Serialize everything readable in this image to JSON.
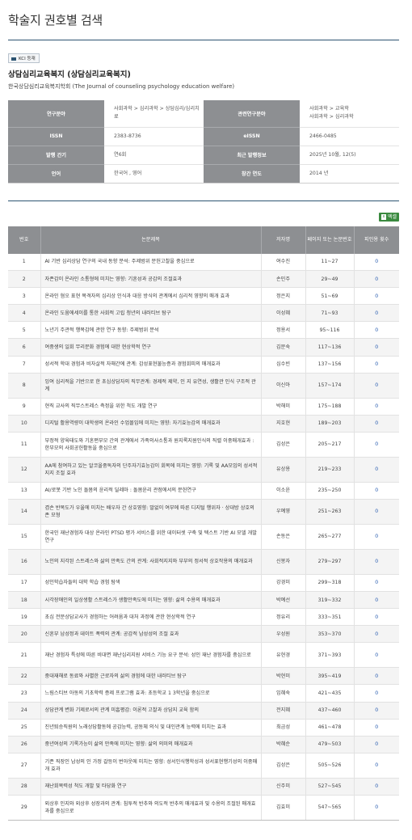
{
  "page": {
    "title": "학술지 권호별 검색"
  },
  "badge": {
    "label": "KCI 등재"
  },
  "journal": {
    "name": "상담심리교육복지 (상담심리교육복지)",
    "publisher": "한국상담심리교육복지학회 (The Journal of counseling psychology education welfare)"
  },
  "info": {
    "research_field_label": "연구분야",
    "research_field_value": "사회과학 > 심리과학 > 상담심리/심리치료",
    "related_field_label": "관련연구분야",
    "related_field_value_1": "사회과학 > 교육학",
    "related_field_value_2": "사회과학 > 심리과학",
    "issn_label": "ISSN",
    "issn_value": "2383-8736",
    "eissn_label": "eISSN",
    "eissn_value": "2466-0485",
    "cycle_label": "발행 간기",
    "cycle_value": "연6회",
    "latest_label": "최근 발행정보",
    "latest_value": "2025년 10월, 12(5)",
    "lang_label": "언어",
    "lang_value": "한국어 , 영어",
    "founded_label": "창간 연도",
    "founded_value": "2014 년"
  },
  "excel": {
    "label": "엑셀"
  },
  "table": {
    "headers": {
      "no": "번호",
      "title": "논문제목",
      "author": "저자명",
      "pages": "페이지 또는 논문번호",
      "cited": "피인용 횟수"
    },
    "rows": [
      {
        "no": "1",
        "title": "AI 기반 심리상담 연구의 국내 동향 분석: 주제범위 문헌고찰을 중심으로",
        "author": "여수진",
        "pages": "11~27",
        "cited": "0"
      },
      {
        "no": "2",
        "title": "자존감이 온라인 소통형에 미치는 영향: 기혼성과 공감의 조절효과",
        "author": "손민주",
        "pages": "29~49",
        "cited": "0"
      },
      {
        "no": "3",
        "title": "온라인 혐오 표현 목격자의 심리상 인식과 대응 방식의 관계에서 심리적 영향의 매개 효과",
        "author": "정은지",
        "pages": "51~69",
        "cited": "0"
      },
      {
        "no": "4",
        "title": "온라인 도움에세이를 통한 사회적 고립 청년의 내러티브 탐구",
        "author": "이성혜",
        "pages": "71~93",
        "cited": "0"
      },
      {
        "no": "5",
        "title": "노년기 주관적 행복감에 관한 연구 동향: 주제범위 분석",
        "author": "정용서",
        "pages": "95~116",
        "cited": "0"
      },
      {
        "no": "6",
        "title": "여중생의 일회 무리문화 경험에 대한 현상학적 연구",
        "author": "김문숙",
        "pages": "117~136",
        "cited": "0"
      },
      {
        "no": "7",
        "title": "성서적 학대 경험과 비자살적 자해간에 관계: 감성표현불능증과 경험회피의 매개효과",
        "author": "심수빈",
        "pages": "137~156",
        "cited": "0"
      },
      {
        "no": "8",
        "title": "잉여 심리적을 기반으로 한 초심상담자의 직무관계: 경제적 제약, 인 지 유연성, 생활관 인식 구조적 관계",
        "author": "이신아",
        "pages": "157~174",
        "cited": "0"
      },
      {
        "no": "9",
        "title": "현직 교사의 직무스트레스 측정을 위한 척도 개발 연구",
        "author": "박해미",
        "pages": "175~188",
        "cited": "0"
      },
      {
        "no": "10",
        "title": "디지털 활용역량이 대학생의 온라인 수업몰입에 미치는 영향: 자기효능감의 매개효과",
        "author": "지호현",
        "pages": "189~203",
        "cited": "0"
      },
      {
        "no": "11",
        "title": "부정적 양육태도와 기혼편부모 간의 관계에서 가족의사소통과 원지록지원인식의 직렬 이중매개효과 : 한부모의 사회공헌활동을 중심으로",
        "author": "김성은",
        "pages": "205~217",
        "cited": "0"
      },
      {
        "no": "12",
        "title": "AA에 참여하고 있는 알코올중독자의 단주자기효능감이 회복에 미치는 영향: 기록 및 AA모임의 성서적지지 조절 효과",
        "author": "유상용",
        "pages": "219~233",
        "cited": "0"
      },
      {
        "no": "13",
        "title": "AI/로봇 기반 노인 돌봄의 윤리적 딜레마 : 돌봄윤리 관점에서의 문헌연구",
        "author": "이소윤",
        "pages": "235~250",
        "cited": "0"
      },
      {
        "no": "14",
        "title": "겸손 반복도가 우울에 미치는 배우자 간 상호영향: 말없이 여부에 따른 디지털 행위자 · 상대방 상호의존 모형",
        "author": "우예영",
        "pages": "251~263",
        "cited": "0"
      },
      {
        "no": "15",
        "title": "한국인 재난경험자 대상 온라인 PTSD 평가 서비스를 위한 데이터셋 구축 및 텍스트 기반 AI 모델 개발 연구",
        "author": "손동은",
        "pages": "265~277",
        "cited": "0"
      },
      {
        "no": "16",
        "title": "노인의 지각된 스트레스와 삶의 만족도 간의 관계: 사회적지지와 부부의 정서적 상호작용의 매개효과",
        "author": "신봉자",
        "pages": "279~297",
        "cited": "0"
      },
      {
        "no": "17",
        "title": "성인학습자들의 대학 학습 경험 탐색",
        "author": "강경미",
        "pages": "299~318",
        "cited": "0"
      },
      {
        "no": "18",
        "title": "시각장애인의 일상생활 스트레스가 생활만족도에 미치는 영향: 삶의 수용의 매개효과",
        "author": "박예선",
        "pages": "319~332",
        "cited": "0"
      },
      {
        "no": "19",
        "title": "초심 전문상담교사가 경험하는 어려움과 대처 과정에 관한 현상학적 연구",
        "author": "정유리",
        "pages": "333~351",
        "cited": "0"
      },
      {
        "no": "20",
        "title": "신혼부 남성정과 데이트 폭력의 관계: 공감적 남성성의 조절 효과",
        "author": "우성원",
        "pages": "353~370",
        "cited": "0"
      },
      {
        "no": "21",
        "title": "재난 경험자 특성에 따른 비대면 재난심리지원 서비스 기능 요구 분석: 성인 재난 경험자를 중심으로",
        "author": "유현경",
        "pages": "371~393",
        "cited": "0"
      },
      {
        "no": "22",
        "title": "중대재해로 동료와 사별한 근로자의 삶의 경험에 대한 내러티브 탐구",
        "author": "박현미",
        "pages": "395~419",
        "cited": "0"
      },
      {
        "no": "23",
        "title": "느림스티브 아동의 기초학력 증제 프로그램 효과: 초등학교 1 3학년을 중심으로",
        "author": "임혜숙",
        "pages": "421~435",
        "cited": "0"
      },
      {
        "no": "24",
        "title": "상담관계 변화 기제로서의 관계 미흡평감: 이론적 고찰과 상담지 교육 함의",
        "author": "전지혜",
        "pages": "437~460",
        "cited": "0"
      },
      {
        "no": "25",
        "title": "진년퇴승직원의 노래상담활동에 공감능력, 공동체 의식 및 대인관계 능력에 미치는 효과",
        "author": "최금성",
        "pages": "461~478",
        "cited": "0"
      },
      {
        "no": "26",
        "title": "중년여성의 기록가능이 삶의 만족에 미치는 영향: 삶의 의미의 매개효과",
        "author": "박혜순",
        "pages": "479~503",
        "cited": "0"
      },
      {
        "no": "27",
        "title": "기존 직장인 남성의 인 가정 갈등이 번아웃에 미치는 영향: 성서인식행학성과 성서표현행기성의 이중매개 효과",
        "author": "김성은",
        "pages": "505~526",
        "cited": "0"
      },
      {
        "no": "28",
        "title": "재난회복력성 척도 개발 및 타당화 연구",
        "author": "신주미",
        "pages": "527~545",
        "cited": "0"
      },
      {
        "no": "29",
        "title": "외상후 인지와 외상후 성장과의 관계: 침투적 반추와 의도적 반추의 매개효과 및 수용의 조절된 매개효과를 중심으로",
        "author": "김효미",
        "pages": "547~565",
        "cited": "0"
      }
    ]
  }
}
